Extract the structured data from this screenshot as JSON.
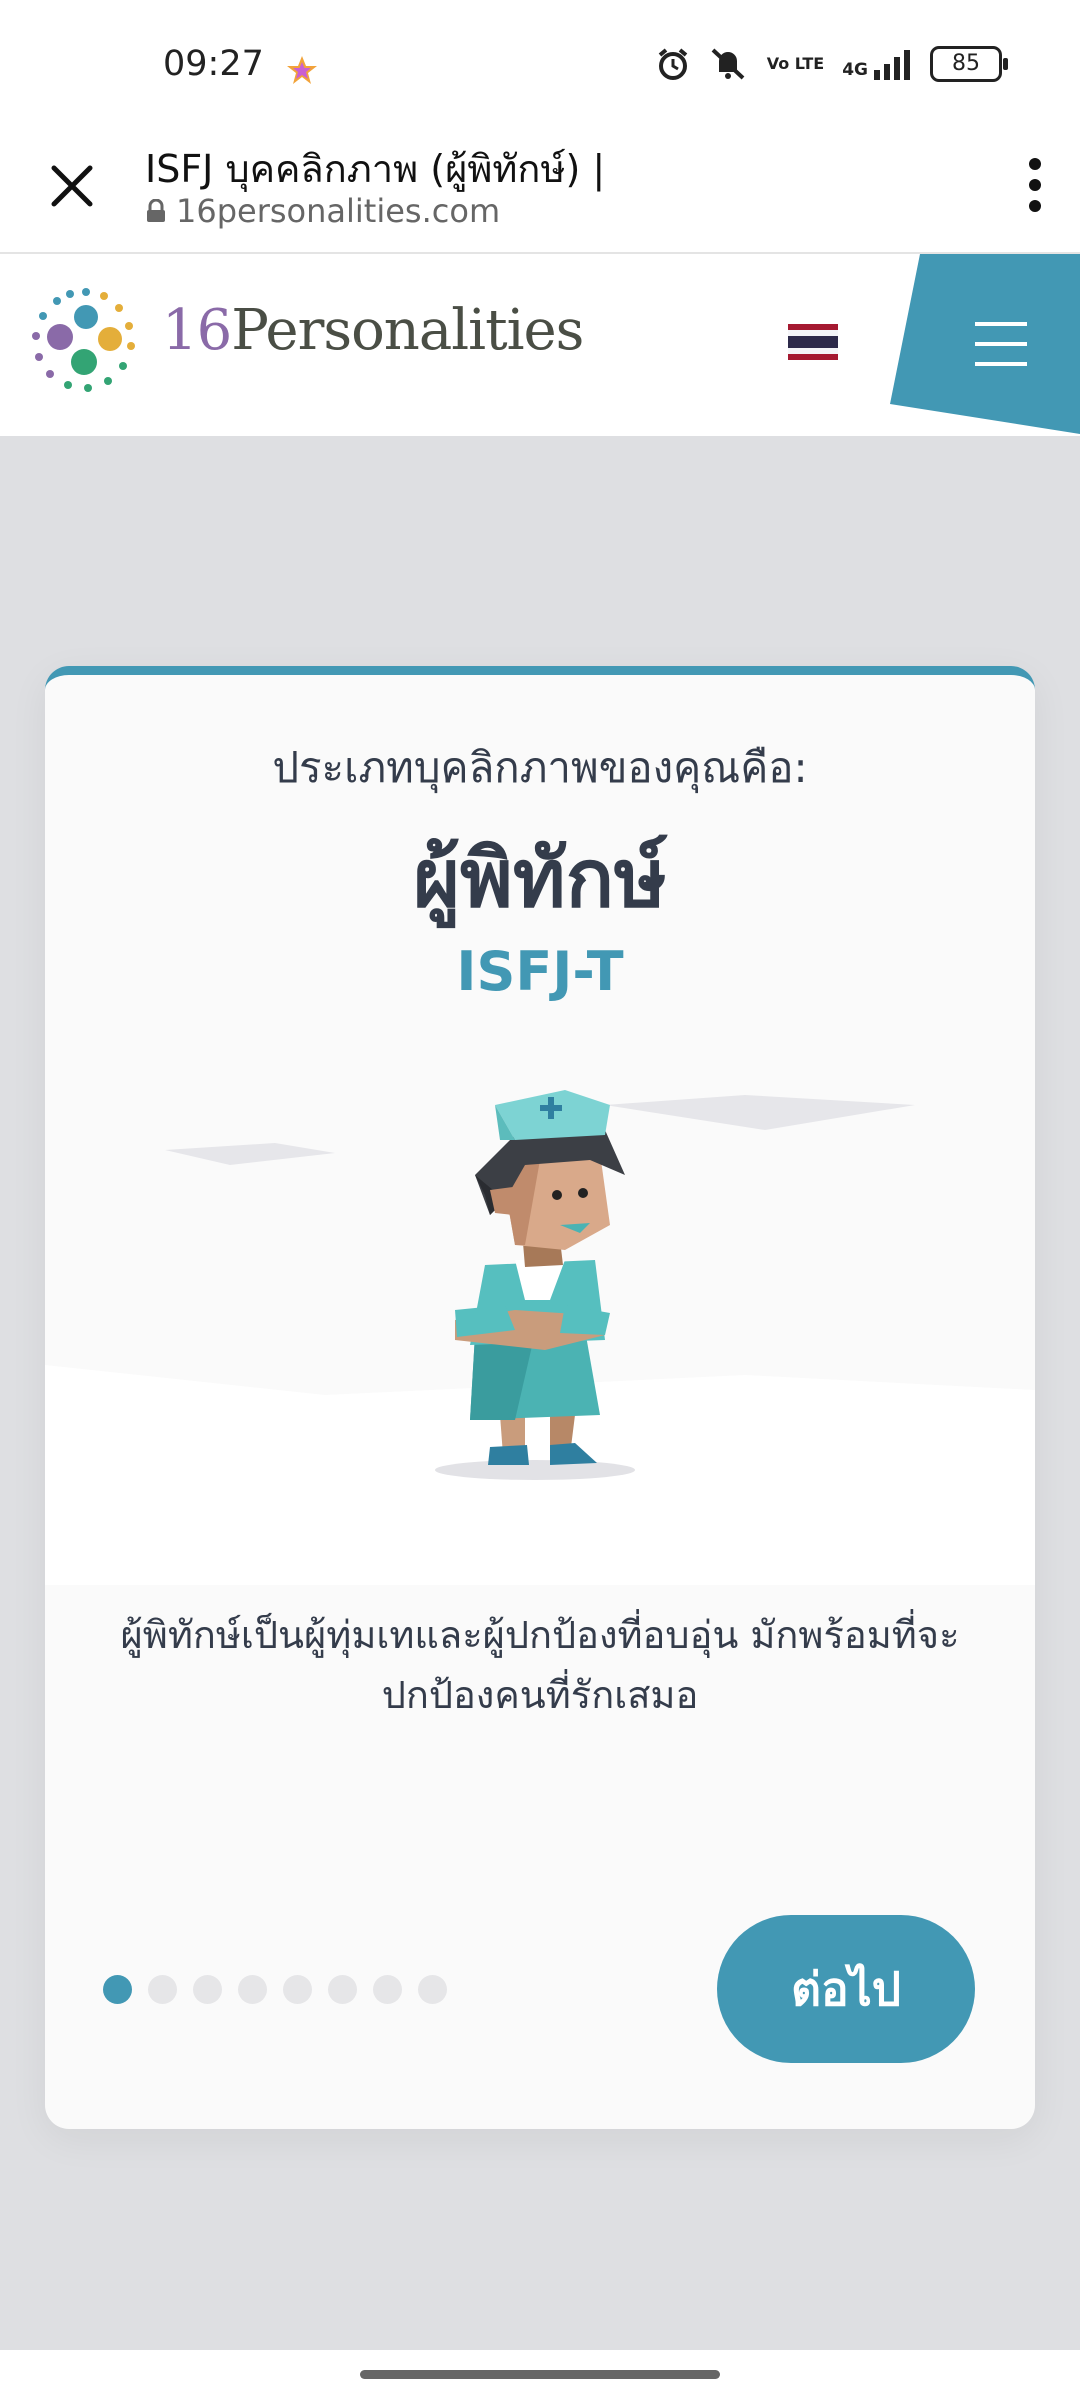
{
  "status_bar": {
    "time": "09:27",
    "volte": "Vo LTE",
    "network": "4G",
    "battery": "85"
  },
  "browser": {
    "tab_title": "ISFJ บุคคลิกภาพ (ผู้พิทักษ์) |",
    "url": "16personalities.com"
  },
  "site": {
    "brand_number": "16",
    "brand_name": "Personalities"
  },
  "card": {
    "subtitle": "ประเภทบุคลิกภาพของคุณคือ:",
    "name": "ผู้พิทักษ์",
    "code": "ISFJ-T",
    "description": "ผู้พิทักษ์เป็นผู้ทุ่มเทและผู้ปกป้องที่อบอุ่น มักพร้อมที่จะปกป้องคนที่รักเสมอ",
    "next_label": "ต่อไป",
    "pagination": {
      "total": 8,
      "current": 1
    }
  },
  "colors": {
    "accent": "#4298b4",
    "text": "#343c4b",
    "background": "#dedfe2"
  }
}
